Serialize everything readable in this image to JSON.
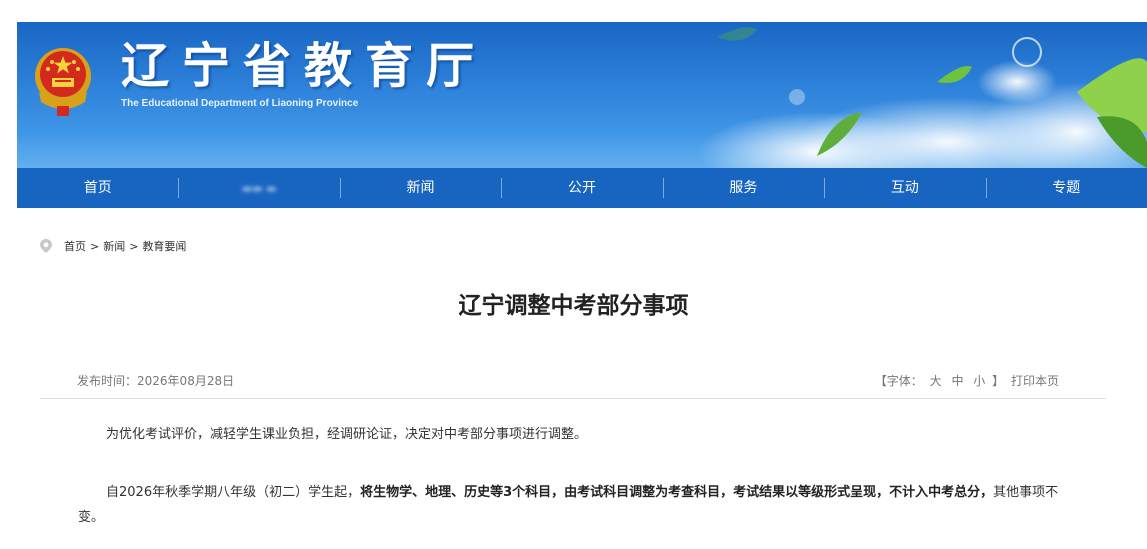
{
  "header": {
    "title": "辽宁省教育厅",
    "subtitle": "The Educational Department of Liaoning Province"
  },
  "nav": {
    "items": [
      "首页",
      "",
      "新闻",
      "公开",
      "服务",
      "互动",
      "专题"
    ]
  },
  "breadcrumb": {
    "home": "首页",
    "separator": ">",
    "news": "新闻",
    "current": "教育要闻"
  },
  "article": {
    "title": "辽宁调整中考部分事项",
    "publish_label": "发布时间：",
    "publish_date": "2026年08月28日",
    "font_label": "【字体：",
    "font_large": "大",
    "font_medium": "中",
    "font_small": "小",
    "font_close": "】",
    "print": "打印本页",
    "para1": "为优化考试评价，减轻学生课业负担，经调研论证，决定对中考部分事项进行调整。",
    "para2_lead": "自2026年秋季学期八年级（初二）学生起，",
    "para2_bold": "将生物学、地理、历史等3个科目，由考试科目调整为考查科目，考试结果以等级形式呈现，不计入中考总分，",
    "para2_tail": "其他事项不变。"
  },
  "colors": {
    "nav_bg": "#1865c1",
    "banner_top": "#1a66c4",
    "banner_bottom": "#63b0ef"
  }
}
